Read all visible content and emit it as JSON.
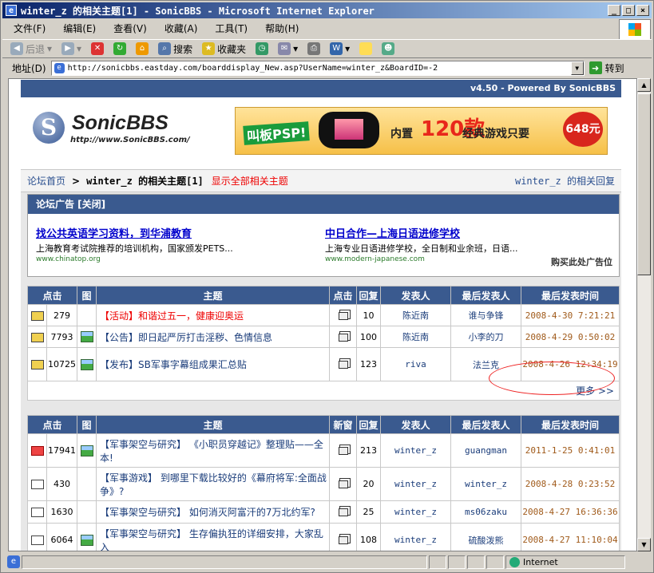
{
  "window": {
    "title": "winter_z 的相关主题[1] - SonicBBS - Microsoft Internet Explorer",
    "icon": "ie-icon"
  },
  "menu": [
    "文件(F)",
    "编辑(E)",
    "查看(V)",
    "收藏(A)",
    "工具(T)",
    "帮助(H)"
  ],
  "toolbar": {
    "back": "后退",
    "search": "搜索",
    "favorites": "收藏夹"
  },
  "address": {
    "label": "地址(D)",
    "url": "http://sonicbbs.eastday.com/boarddisplay_New.asp?UserName=winter_z&BoardID=-2",
    "go": "转到"
  },
  "status": {
    "zone": "Internet"
  },
  "page": {
    "version": "v4.50 - Powered By SonicBBS",
    "logo": {
      "name": "SonicBBS",
      "url": "http://www.SonicBBS.com/"
    },
    "banner": {
      "t1": "叫板PSP!",
      "t2": "内置",
      "t3": "120款",
      "t4": "经典游戏只要",
      "price": "648元"
    },
    "crumbs": {
      "home": "论坛首页",
      "sep": ">",
      "current": "winter_z 的相关主题[1]",
      "all": "显示全部相关主题",
      "right": "winter_z 的相关回复"
    },
    "ads": {
      "header": "论坛广告  [关闭]",
      "items": [
        {
          "title": "找公共英语学习资料，到华浦教育",
          "desc": "上海教育考试院推荐的培训机构，国家颁发PETS...",
          "url": "www.chinatop.org"
        },
        {
          "title": "中日合作—上海日语进修学校",
          "desc": "上海专业日语进修学校，全日制和业余班，日语...",
          "url": "www.modern-japanese.com"
        }
      ],
      "buy": "购买此处广告位"
    },
    "table1": {
      "headers": [
        "点击",
        "图",
        "主题",
        "点击",
        "回复",
        "发表人",
        "最后发表人",
        "最后发表时间"
      ],
      "rows": [
        {
          "hits": "279",
          "pic": false,
          "subject": "【活动】和谐过五一，健康迎奥运",
          "red": true,
          "replies": "10",
          "author": "陈近南",
          "last": "谁与争锋",
          "time": "2008-4-30 7:21:21"
        },
        {
          "hits": "7793",
          "pic": true,
          "subject": "【公告】即日起严厉打击淫秽、色情信息",
          "red": false,
          "replies": "100",
          "author": "陈近南",
          "last": "小李的刀",
          "time": "2008-4-29 0:50:02"
        },
        {
          "hits": "10725",
          "pic": true,
          "subject": "【发布】SB军事字幕组成果汇总贴",
          "red": false,
          "replies": "123",
          "author": "riva",
          "last": "法兰克",
          "time": "2008-4-26 12:34:19"
        }
      ],
      "more": "更多 >>"
    },
    "table2": {
      "headers": [
        "点击",
        "图",
        "主题",
        "新窗",
        "回复",
        "发表人",
        "最后发表人",
        "最后发表时间"
      ],
      "rows": [
        {
          "hits": "17941",
          "pic": true,
          "subject": "【军事架空与研究】 《小职员穿越记》整理贴——全本!",
          "replies": "213",
          "author": "winter_z",
          "last": "guangman",
          "time": "2011-1-25 0:41:01",
          "icon": "red"
        },
        {
          "hits": "430",
          "pic": false,
          "subject": "【军事游戏】 到哪里下载比较好的《幕府将军:全面战争》?",
          "replies": "20",
          "author": "winter_z",
          "last": "winter_z",
          "time": "2008-4-28 0:23:52",
          "icon": "open"
        },
        {
          "hits": "1630",
          "pic": false,
          "subject": "【军事架空与研究】 如何消灭阿富汗的7万北约军?",
          "replies": "25",
          "author": "winter_z",
          "last": "ms06zaku",
          "time": "2008-4-27 16:36:36",
          "icon": "open"
        },
        {
          "hits": "6064",
          "pic": true,
          "subject": "【军事架空与研究】 生存偏执狂的详细安排，大家乱入",
          "replies": "108",
          "author": "winter_z",
          "last": "硫酸泼熊",
          "time": "2008-4-27 11:10:04",
          "icon": "open"
        }
      ]
    }
  }
}
